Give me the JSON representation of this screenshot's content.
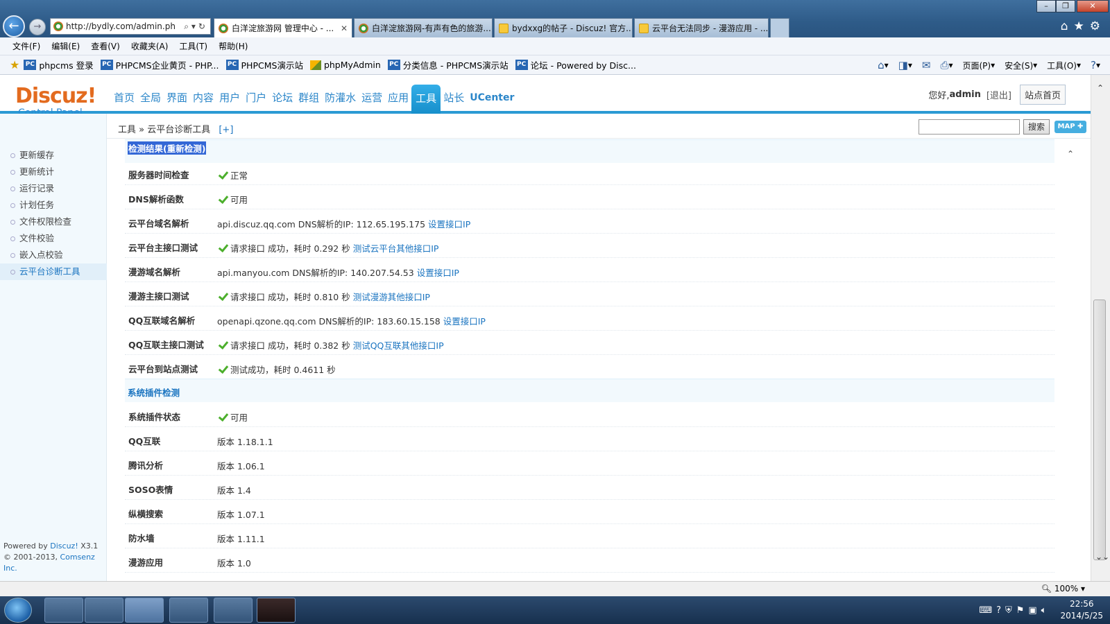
{
  "browser": {
    "address": "http://bydly.com/admin.ph",
    "tabs": [
      {
        "title": "白洋淀旅游网 管理中心 - ...",
        "active": true
      },
      {
        "title": "白洋淀旅游网-有声有色的旅游..."
      },
      {
        "title": "bydxxg的帖子 - Discuz! 官方..."
      },
      {
        "title": "云平台无法同步 - 漫游应用 - ..."
      }
    ],
    "menu": [
      "文件(F)",
      "编辑(E)",
      "查看(V)",
      "收藏夹(A)",
      "工具(T)",
      "帮助(H)"
    ],
    "favorites": [
      {
        "label": "phpcms 登录",
        "icon": "pc"
      },
      {
        "label": "PHPCMS企业黄页 - PHP...",
        "icon": "pc"
      },
      {
        "label": "PHPCMS演示站",
        "icon": "pc"
      },
      {
        "label": "phpMyAdmin",
        "icon": "pma"
      },
      {
        "label": "分类信息 - PHPCMS演示站",
        "icon": "pc"
      },
      {
        "label": "论坛 - Powered by Disc...",
        "icon": "pc"
      }
    ],
    "commands": {
      "page": "页面(P)",
      "safety": "安全(S)",
      "tools": "工具(O)"
    },
    "zoom": "100%"
  },
  "header": {
    "logo_main": "Discuz!",
    "logo_sub": "Control Panel",
    "nav": [
      "首页",
      "全局",
      "界面",
      "内容",
      "用户",
      "门户",
      "论坛",
      "群组",
      "防灌水",
      "运营",
      "应用",
      "工具",
      "站长",
      "UCenter"
    ],
    "active_nav": "工具",
    "greeting": "您好,",
    "admin": "admin",
    "logout": "[退出]",
    "home_button": "站点首页"
  },
  "sidebar": {
    "items": [
      "更新缓存",
      "更新统计",
      "运行记录",
      "计划任务",
      "文件权限检查",
      "文件校验",
      "嵌入点校验",
      "云平台诊断工具"
    ],
    "active": "云平台诊断工具",
    "footer_powered": "Powered by",
    "footer_brand": "Discuz!",
    "footer_version": "X3.1",
    "footer_copy": "© 2001-2013,",
    "footer_company": "Comsenz Inc."
  },
  "breadcrumb": {
    "path": "工具 » 云平台诊断工具",
    "toggle": "[+]",
    "search_button": "搜索",
    "map_button": "MAP ✚"
  },
  "results": {
    "section1_title": "检测结果(重新检测)",
    "rows1": [
      {
        "label": "服务器时间检查",
        "check": true,
        "text": "正常",
        "link": ""
      },
      {
        "label": "DNS解析函数",
        "check": true,
        "text": "可用",
        "link": ""
      },
      {
        "label": "云平台域名解析",
        "check": false,
        "text": "api.discuz.qq.com DNS解析的IP: 112.65.195.175",
        "link": "设置接口IP"
      },
      {
        "label": "云平台主接口测试",
        "check": true,
        "text": "请求接口 成功，耗时 0.292 秒",
        "link": "测试云平台其他接口IP"
      },
      {
        "label": "漫游域名解析",
        "check": false,
        "text": "api.manyou.com DNS解析的IP: 140.207.54.53",
        "link": "设置接口IP"
      },
      {
        "label": "漫游主接口测试",
        "check": true,
        "text": "请求接口 成功，耗时 0.810 秒",
        "link": "测试漫游其他接口IP"
      },
      {
        "label": "QQ互联域名解析",
        "check": false,
        "text": "openapi.qzone.qq.com DNS解析的IP: 183.60.15.158",
        "link": "设置接口IP"
      },
      {
        "label": "QQ互联主接口测试",
        "check": true,
        "text": "请求接口 成功，耗时 0.382 秒",
        "link": "测试QQ互联其他接口IP"
      },
      {
        "label": "云平台到站点测试",
        "check": true,
        "text": "测试成功，耗时 0.4611 秒",
        "link": ""
      }
    ],
    "section2_title": "系统插件检测",
    "rows2": [
      {
        "label": "系统插件状态",
        "check": true,
        "text": "可用",
        "link": ""
      },
      {
        "label": "QQ互联",
        "check": false,
        "text": "版本 1.18.1.1",
        "link": ""
      },
      {
        "label": "腾讯分析",
        "check": false,
        "text": "版本 1.06.1",
        "link": ""
      },
      {
        "label": "SOSO表情",
        "check": false,
        "text": "版本 1.4",
        "link": ""
      },
      {
        "label": "纵横搜索",
        "check": false,
        "text": "版本 1.07.1",
        "link": ""
      },
      {
        "label": "防水墙",
        "check": false,
        "text": "版本 1.11.1",
        "link": ""
      },
      {
        "label": "漫游应用",
        "check": false,
        "text": "版本 1.0",
        "link": ""
      }
    ]
  },
  "taskbar": {
    "time": "22:56",
    "date": "2014/5/25"
  }
}
